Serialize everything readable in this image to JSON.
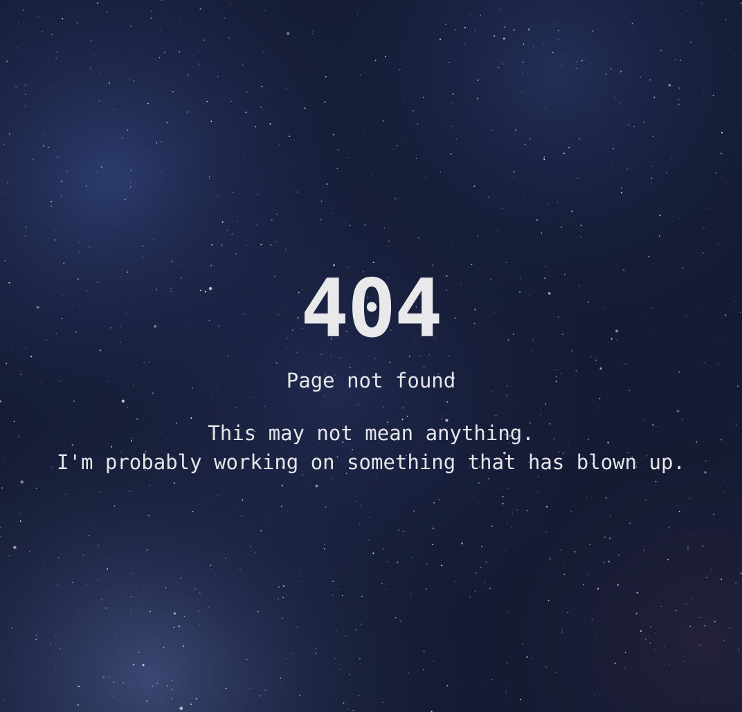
{
  "error": {
    "code": "404",
    "title": "Page not found",
    "message_lines": [
      "This may not mean anything.",
      "I'm probably working on something that has blown up."
    ]
  },
  "background": {
    "description_icon": "starry-night-sky",
    "base_color": "#141a33",
    "nebula_color": "#3a4f8c",
    "text_color": "#e6e6ea"
  }
}
